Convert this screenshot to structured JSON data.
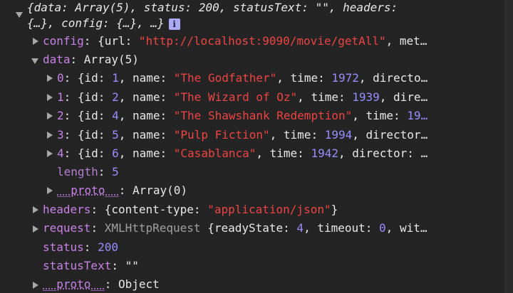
{
  "console": {
    "summary_line1": "{data: Array(5), status: 200, statusText: \"\", headers:",
    "summary_line2": "{…}, config: {…}, …}",
    "info_badge": "i",
    "config": {
      "key": "config",
      "open": ": {url: ",
      "url": "\"http://localhost:9090/movie/getAll\"",
      "rest": ", met…"
    },
    "data": {
      "key": "data",
      "value": ": Array(5)",
      "items": [
        {
          "index": "0",
          "id": "1",
          "name": "\"The Godfather\"",
          "time": "1972",
          "tail": ", directo…"
        },
        {
          "index": "1",
          "id": "2",
          "name": "\"The Wizard of Oz\"",
          "time": "1939",
          "tail": ", dire…"
        },
        {
          "index": "2",
          "id": "4",
          "name": "\"The Shawshank Redemption\"",
          "time": "19…",
          "tail": ""
        },
        {
          "index": "3",
          "id": "5",
          "name": "\"Pulp Fiction\"",
          "time": "1994",
          "tail": ", director…"
        },
        {
          "index": "4",
          "id": "6",
          "name": "\"Casablanca\"",
          "time": "1942",
          "tail": ", director: …"
        }
      ],
      "length_key": "length",
      "length_value": "5",
      "proto_key": "__proto__",
      "proto_value": ": Array(0)"
    },
    "headers": {
      "key": "headers",
      "open": ": {content-type: ",
      "value": "\"application/json\"",
      "close": "}"
    },
    "request": {
      "key": "request",
      "type": "XMLHttpRequest",
      "open": " {readyState: ",
      "ready_state": "4",
      "mid": ", timeout: ",
      "timeout": "0",
      "rest": ", wit…"
    },
    "status": {
      "key": "status",
      "value": "200"
    },
    "statusText": {
      "key": "statusText",
      "value": "\"\""
    },
    "root_proto": {
      "key": "__proto__",
      "value": ": Object"
    },
    "labels": {
      "colon": ": ",
      "brace_id": ": {id: ",
      "name_label": ", name: ",
      "time_label": ", time: "
    }
  }
}
